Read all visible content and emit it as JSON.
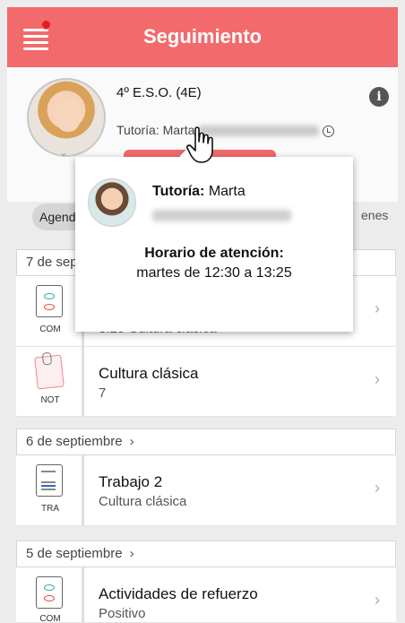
{
  "header": {
    "title": "Seguimiento",
    "menu_icon": "menu-icon",
    "notification_color": "#e31b23",
    "accent": "#f26a6c"
  },
  "profile": {
    "course": "4º E.S.O. (4E)",
    "tutor_label": "Tutoría: Marta",
    "info_icon": "more-vert-icon",
    "clock_icon": "clock-icon"
  },
  "tabs": {
    "agenda": "Agenda",
    "right_tab": "enes"
  },
  "popup": {
    "tutor_label": "Tutoría:",
    "tutor_name": "Marta",
    "hours_title": "Horario de atención:",
    "hours": "martes de 12:30 a 13:25"
  },
  "sections": [
    {
      "date": "7 de septiembre",
      "items": [
        {
          "icon": "comunicacion-icon",
          "code": "COM",
          "title": "",
          "subtitle": "8:25 Cultura clásica"
        },
        {
          "icon": "nota-icon",
          "code": "NOT",
          "title": "Cultura clásica",
          "subtitle": "7"
        }
      ]
    },
    {
      "date": "6 de septiembre",
      "items": [
        {
          "icon": "trabajo-icon",
          "code": "TRA",
          "title": "Trabajo 2",
          "subtitle": "Cultura clásica"
        }
      ]
    },
    {
      "date": "5 de septiembre",
      "items": [
        {
          "icon": "comunicacion-icon",
          "code": "COM",
          "title": "Actividades de refuerzo",
          "subtitle": "Positivo"
        }
      ]
    }
  ]
}
